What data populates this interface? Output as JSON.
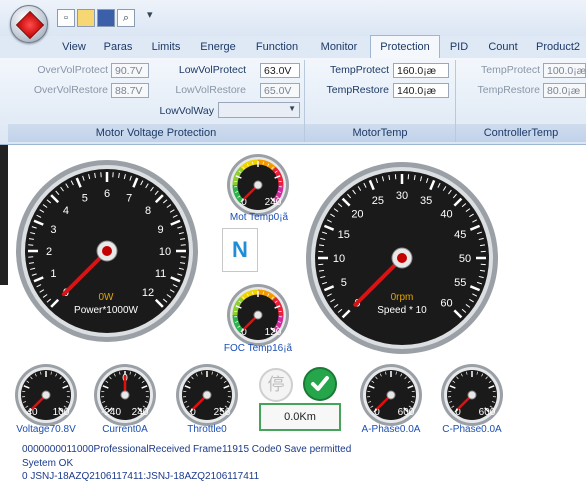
{
  "quick_access": {
    "icons": [
      "new-file-icon",
      "open-folder-icon",
      "save-icon",
      "print-preview-icon"
    ],
    "more": "▾"
  },
  "tabs": [
    "View",
    "Paras",
    "Limits",
    "Energe",
    "Function",
    "Monitor",
    "Protection",
    "PID",
    "Count",
    "Product2"
  ],
  "active_tab": "Protection",
  "ribbon": {
    "motor_voltage": {
      "label": "Motor Voltage Protection",
      "over_vol_protect_label": "OverVolProtect",
      "over_vol_protect_value": "90.7V",
      "over_vol_restore_label": "OverVolRestore",
      "over_vol_restore_value": "88.7V",
      "low_vol_protect_label": "LowVolProtect",
      "low_vol_protect_value": "63.0V",
      "low_vol_restore_label": "LowVolRestore",
      "low_vol_restore_value": "65.0V",
      "low_vol_way_label": "LowVolWay",
      "low_vol_way_value": ""
    },
    "motor_temp": {
      "label": "MotorTemp",
      "temp_protect_label": "TempProtect",
      "temp_protect_value": "160.0¡æ",
      "temp_restore_label": "TempRestore",
      "temp_restore_value": "140.0¡æ"
    },
    "controller_temp": {
      "label": "ControllerTemp",
      "temp_protect_label": "TempProtect",
      "temp_protect_value": "100.0¡æ",
      "temp_restore_label": "TempRestore",
      "temp_restore_value": "80.0¡æ"
    }
  },
  "gauges": {
    "power": {
      "ticks": [
        "0",
        "1",
        "2",
        "3",
        "4",
        "5",
        "6",
        "7",
        "8",
        "9",
        "10",
        "11",
        "12"
      ],
      "value_text": "0W",
      "caption": "Power*1000W",
      "level": 0
    },
    "speed": {
      "ticks": [
        "0",
        "5",
        "10",
        "15",
        "20",
        "25",
        "30",
        "35",
        "40",
        "45",
        "50",
        "55",
        "60"
      ],
      "value_text": "0rpm",
      "caption": "Speed * 10",
      "level": 0
    },
    "mot_temp": {
      "min": "0",
      "max": "240",
      "caption": "Mot Temp0¡ã"
    },
    "foc_temp": {
      "min": "0",
      "max": "120",
      "caption": "FOC Temp16¡ã"
    },
    "voltage": {
      "min": "40",
      "max": "100",
      "caption": "Voltage70.8V"
    },
    "current": {
      "min": "-240",
      "max": "240",
      "center": "0",
      "caption": "Current0A"
    },
    "throttle": {
      "min": "0",
      "max": "256",
      "caption": "Throttle0"
    },
    "a_phase": {
      "min": "0",
      "max": "600",
      "caption": "A-Phase0.0A"
    },
    "c_phase": {
      "min": "0",
      "max": "600",
      "caption": "C-Phase0.0A"
    }
  },
  "gear_indicator": "N",
  "stop_glyph": "停",
  "distance": "0.0Km",
  "log_lines": [
    "0000000011000ProfessionalReceived Frame11915 Code0 Save permitted",
    "Syetem OK",
    "0 JSNJ-18AZQ2106117411:JSNJ-18AZQ2106117411"
  ],
  "colors": {
    "accent": "#1b4fb2",
    "needle": "#e01010",
    "gauge_face": "#1a1a1a",
    "ok_green": "#26a64a"
  }
}
